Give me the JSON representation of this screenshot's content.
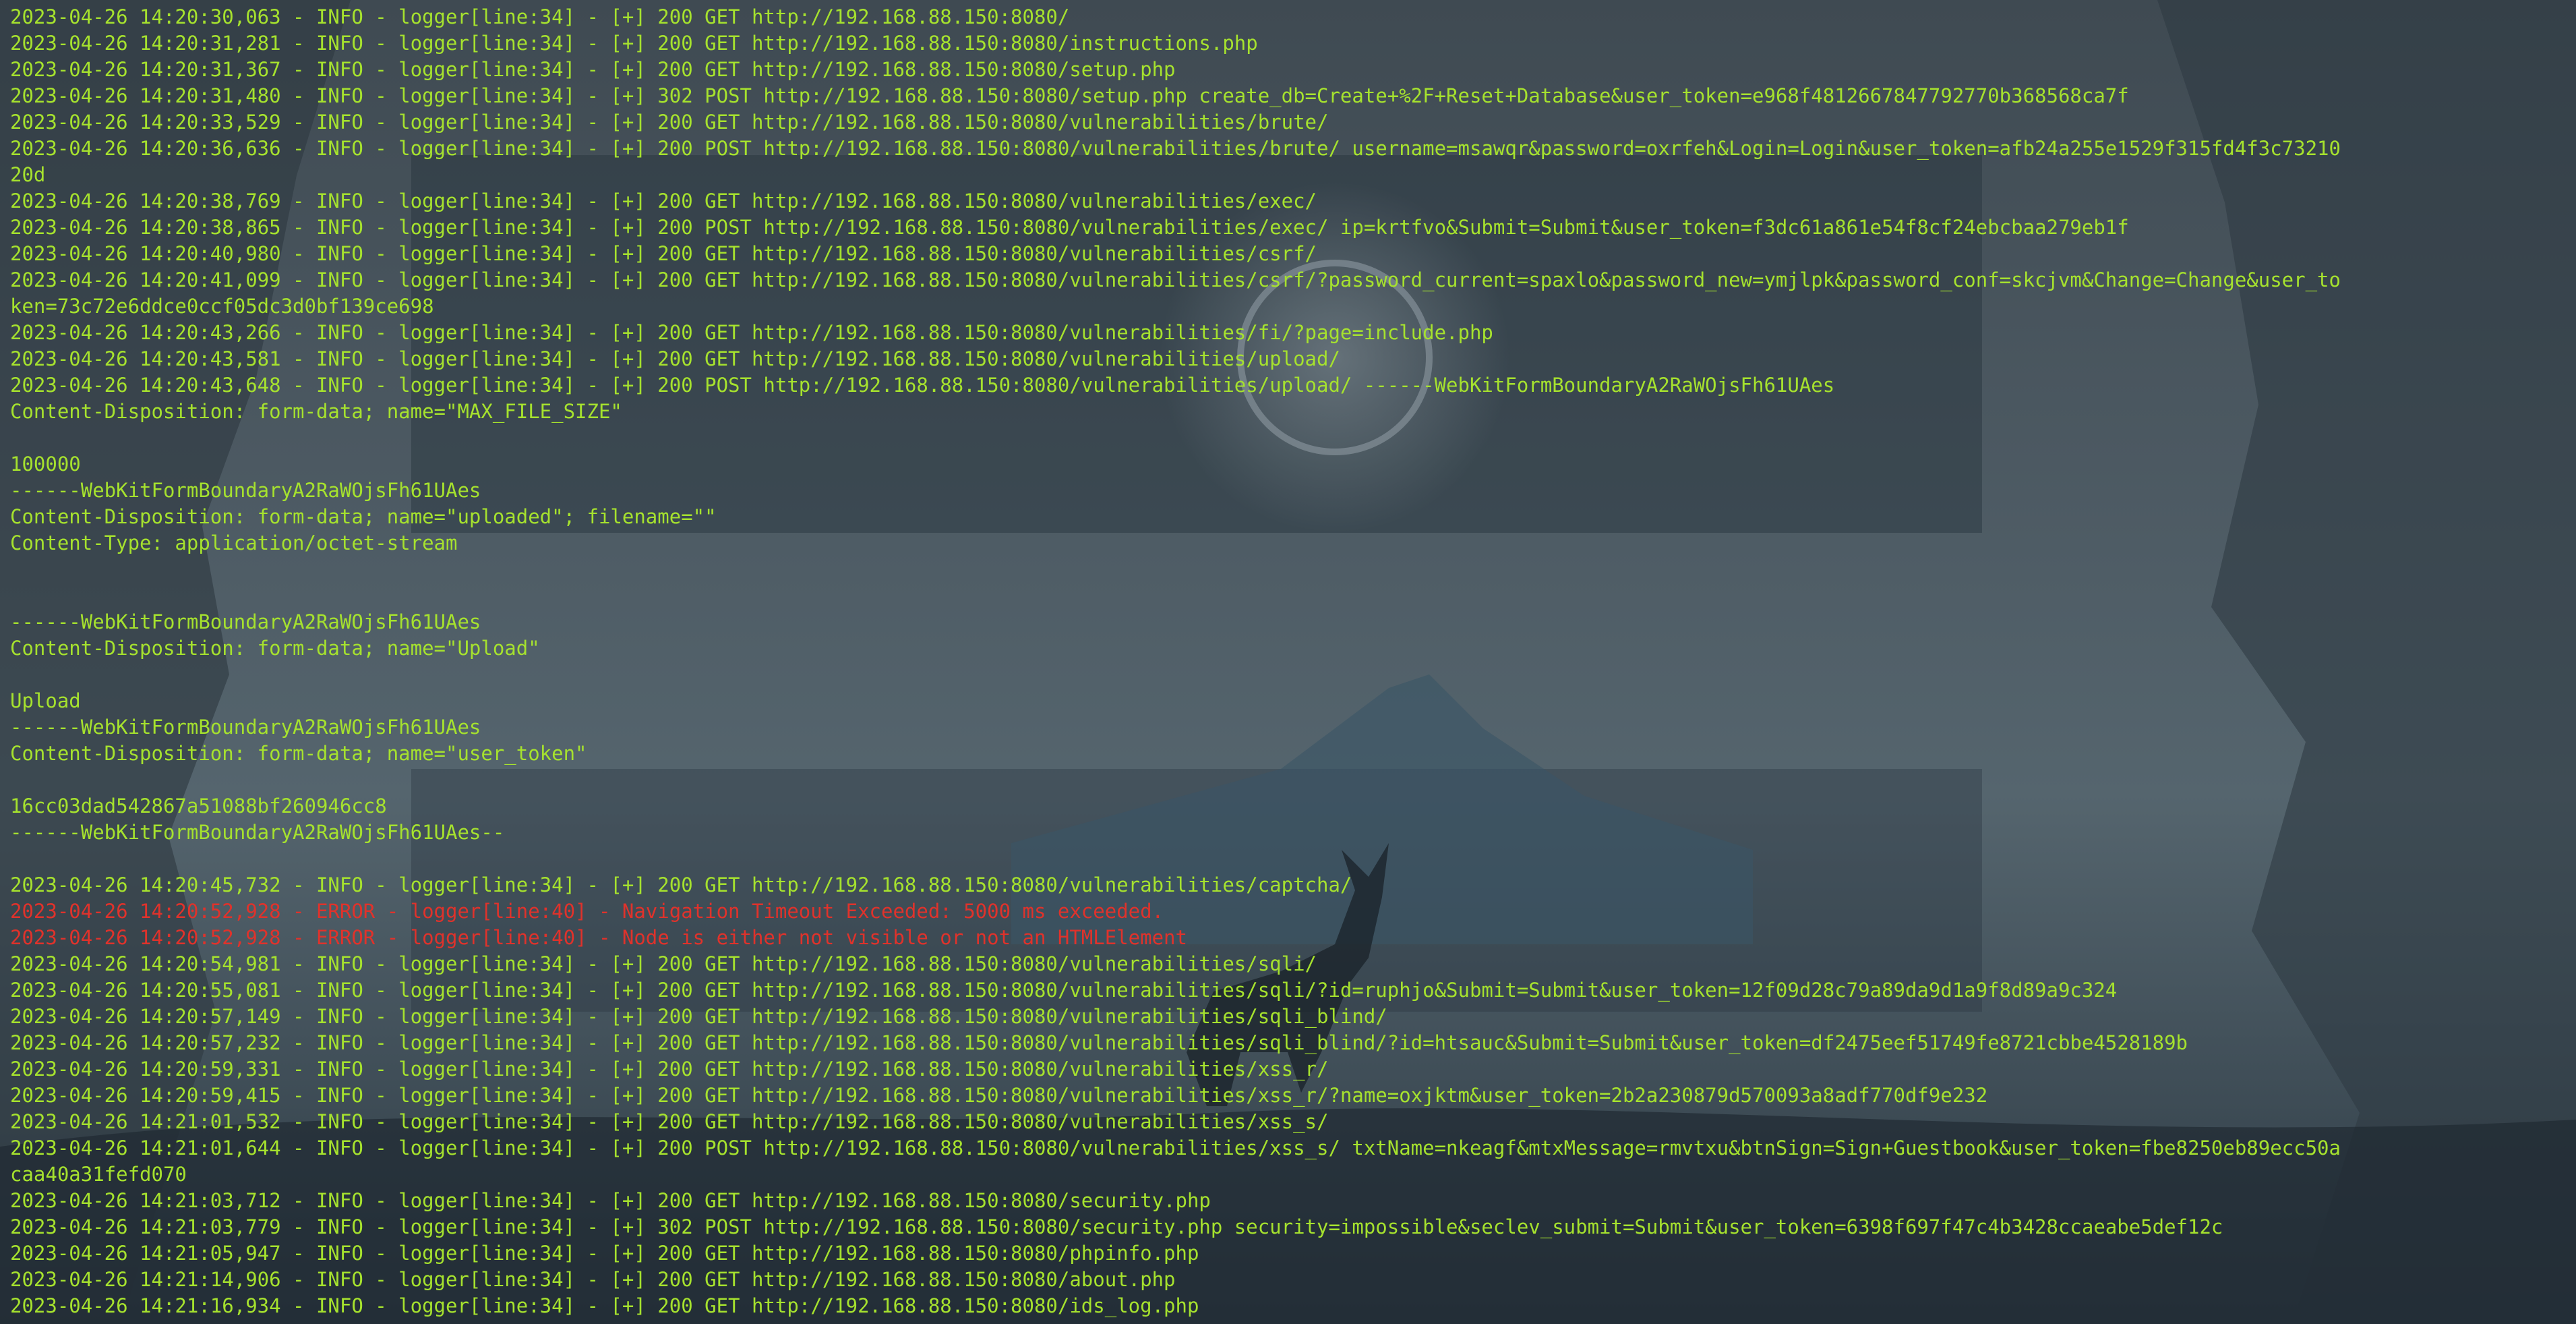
{
  "colors": {
    "info": "#a6e22e",
    "error": "#e0322b",
    "background": "#4a5660"
  },
  "terminal": {
    "lines": [
      {
        "level": "info",
        "text": "2023-04-26 14:20:30,063 - INFO - logger[line:34] - [+] 200 GET http://192.168.88.150:8080/"
      },
      {
        "level": "info",
        "text": "2023-04-26 14:20:31,281 - INFO - logger[line:34] - [+] 200 GET http://192.168.88.150:8080/instructions.php"
      },
      {
        "level": "info",
        "text": "2023-04-26 14:20:31,367 - INFO - logger[line:34] - [+] 200 GET http://192.168.88.150:8080/setup.php"
      },
      {
        "level": "info",
        "text": "2023-04-26 14:20:31,480 - INFO - logger[line:34] - [+] 302 POST http://192.168.88.150:8080/setup.php create_db=Create+%2F+Reset+Database&user_token=e968f4812667847792770b368568ca7f"
      },
      {
        "level": "info",
        "text": "2023-04-26 14:20:33,529 - INFO - logger[line:34] - [+] 200 GET http://192.168.88.150:8080/vulnerabilities/brute/"
      },
      {
        "level": "info",
        "text": "2023-04-26 14:20:36,636 - INFO - logger[line:34] - [+] 200 POST http://192.168.88.150:8080/vulnerabilities/brute/ username=msawqr&password=oxrfeh&Login=Login&user_token=afb24a255e1529f315fd4f3c73210"
      },
      {
        "level": "info",
        "text": "20d"
      },
      {
        "level": "info",
        "text": "2023-04-26 14:20:38,769 - INFO - logger[line:34] - [+] 200 GET http://192.168.88.150:8080/vulnerabilities/exec/"
      },
      {
        "level": "info",
        "text": "2023-04-26 14:20:38,865 - INFO - logger[line:34] - [+] 200 POST http://192.168.88.150:8080/vulnerabilities/exec/ ip=krtfvo&Submit=Submit&user_token=f3dc61a861e54f8cf24ebcbaa279eb1f"
      },
      {
        "level": "info",
        "text": "2023-04-26 14:20:40,980 - INFO - logger[line:34] - [+] 200 GET http://192.168.88.150:8080/vulnerabilities/csrf/"
      },
      {
        "level": "info",
        "text": "2023-04-26 14:20:41,099 - INFO - logger[line:34] - [+] 200 GET http://192.168.88.150:8080/vulnerabilities/csrf/?password_current=spaxlo&password_new=ymjlpk&password_conf=skcjvm&Change=Change&user_to"
      },
      {
        "level": "info",
        "text": "ken=73c72e6ddce0ccf05dc3d0bf139ce698"
      },
      {
        "level": "info",
        "text": "2023-04-26 14:20:43,266 - INFO - logger[line:34] - [+] 200 GET http://192.168.88.150:8080/vulnerabilities/fi/?page=include.php"
      },
      {
        "level": "info",
        "text": "2023-04-26 14:20:43,581 - INFO - logger[line:34] - [+] 200 GET http://192.168.88.150:8080/vulnerabilities/upload/"
      },
      {
        "level": "info",
        "text": "2023-04-26 14:20:43,648 - INFO - logger[line:34] - [+] 200 POST http://192.168.88.150:8080/vulnerabilities/upload/ ------WebKitFormBoundaryA2RaWOjsFh61UAes"
      },
      {
        "level": "info",
        "text": "Content-Disposition: form-data; name=\"MAX_FILE_SIZE\""
      },
      {
        "level": "info",
        "text": ""
      },
      {
        "level": "info",
        "text": "100000"
      },
      {
        "level": "info",
        "text": "------WebKitFormBoundaryA2RaWOjsFh61UAes"
      },
      {
        "level": "info",
        "text": "Content-Disposition: form-data; name=\"uploaded\"; filename=\"\""
      },
      {
        "level": "info",
        "text": "Content-Type: application/octet-stream"
      },
      {
        "level": "info",
        "text": ""
      },
      {
        "level": "info",
        "text": ""
      },
      {
        "level": "info",
        "text": "------WebKitFormBoundaryA2RaWOjsFh61UAes"
      },
      {
        "level": "info",
        "text": "Content-Disposition: form-data; name=\"Upload\""
      },
      {
        "level": "info",
        "text": ""
      },
      {
        "level": "info",
        "text": "Upload"
      },
      {
        "level": "info",
        "text": "------WebKitFormBoundaryA2RaWOjsFh61UAes"
      },
      {
        "level": "info",
        "text": "Content-Disposition: form-data; name=\"user_token\""
      },
      {
        "level": "info",
        "text": ""
      },
      {
        "level": "info",
        "text": "16cc03dad542867a51088bf260946cc8"
      },
      {
        "level": "info",
        "text": "------WebKitFormBoundaryA2RaWOjsFh61UAes--"
      },
      {
        "level": "info",
        "text": ""
      },
      {
        "level": "info",
        "text": "2023-04-26 14:20:45,732 - INFO - logger[line:34] - [+] 200 GET http://192.168.88.150:8080/vulnerabilities/captcha/"
      },
      {
        "level": "error",
        "text": "2023-04-26 14:20:52,928 - ERROR - logger[line:40] - Navigation Timeout Exceeded: 5000 ms exceeded."
      },
      {
        "level": "error",
        "text": "2023-04-26 14:20:52,928 - ERROR - logger[line:40] - Node is either not visible or not an HTMLElement"
      },
      {
        "level": "info",
        "text": "2023-04-26 14:20:54,981 - INFO - logger[line:34] - [+] 200 GET http://192.168.88.150:8080/vulnerabilities/sqli/"
      },
      {
        "level": "info",
        "text": "2023-04-26 14:20:55,081 - INFO - logger[line:34] - [+] 200 GET http://192.168.88.150:8080/vulnerabilities/sqli/?id=ruphjo&Submit=Submit&user_token=12f09d28c79a89da9d1a9f8d89a9c324"
      },
      {
        "level": "info",
        "text": "2023-04-26 14:20:57,149 - INFO - logger[line:34] - [+] 200 GET http://192.168.88.150:8080/vulnerabilities/sqli_blind/"
      },
      {
        "level": "info",
        "text": "2023-04-26 14:20:57,232 - INFO - logger[line:34] - [+] 200 GET http://192.168.88.150:8080/vulnerabilities/sqli_blind/?id=htsauc&Submit=Submit&user_token=df2475eef51749fe8721cbbe4528189b"
      },
      {
        "level": "info",
        "text": "2023-04-26 14:20:59,331 - INFO - logger[line:34] - [+] 200 GET http://192.168.88.150:8080/vulnerabilities/xss_r/"
      },
      {
        "level": "info",
        "text": "2023-04-26 14:20:59,415 - INFO - logger[line:34] - [+] 200 GET http://192.168.88.150:8080/vulnerabilities/xss_r/?name=oxjktm&user_token=2b2a230879d570093a8adf770df9e232"
      },
      {
        "level": "info",
        "text": "2023-04-26 14:21:01,532 - INFO - logger[line:34] - [+] 200 GET http://192.168.88.150:8080/vulnerabilities/xss_s/"
      },
      {
        "level": "info",
        "text": "2023-04-26 14:21:01,644 - INFO - logger[line:34] - [+] 200 POST http://192.168.88.150:8080/vulnerabilities/xss_s/ txtName=nkeagf&mtxMessage=rmvtxu&btnSign=Sign+Guestbook&user_token=fbe8250eb89ecc50a"
      },
      {
        "level": "info",
        "text": "caa40a31fefd070"
      },
      {
        "level": "info",
        "text": "2023-04-26 14:21:03,712 - INFO - logger[line:34] - [+] 200 GET http://192.168.88.150:8080/security.php"
      },
      {
        "level": "info",
        "text": "2023-04-26 14:21:03,779 - INFO - logger[line:34] - [+] 302 POST http://192.168.88.150:8080/security.php security=impossible&seclev_submit=Submit&user_token=6398f697f47c4b3428ccaeabe5def12c"
      },
      {
        "level": "info",
        "text": "2023-04-26 14:21:05,947 - INFO - logger[line:34] - [+] 200 GET http://192.168.88.150:8080/phpinfo.php"
      },
      {
        "level": "info",
        "text": "2023-04-26 14:21:14,906 - INFO - logger[line:34] - [+] 200 GET http://192.168.88.150:8080/about.php"
      },
      {
        "level": "info",
        "text": "2023-04-26 14:21:16,934 - INFO - logger[line:34] - [+] 200 GET http://192.168.88.150:8080/ids_log.php"
      }
    ]
  }
}
